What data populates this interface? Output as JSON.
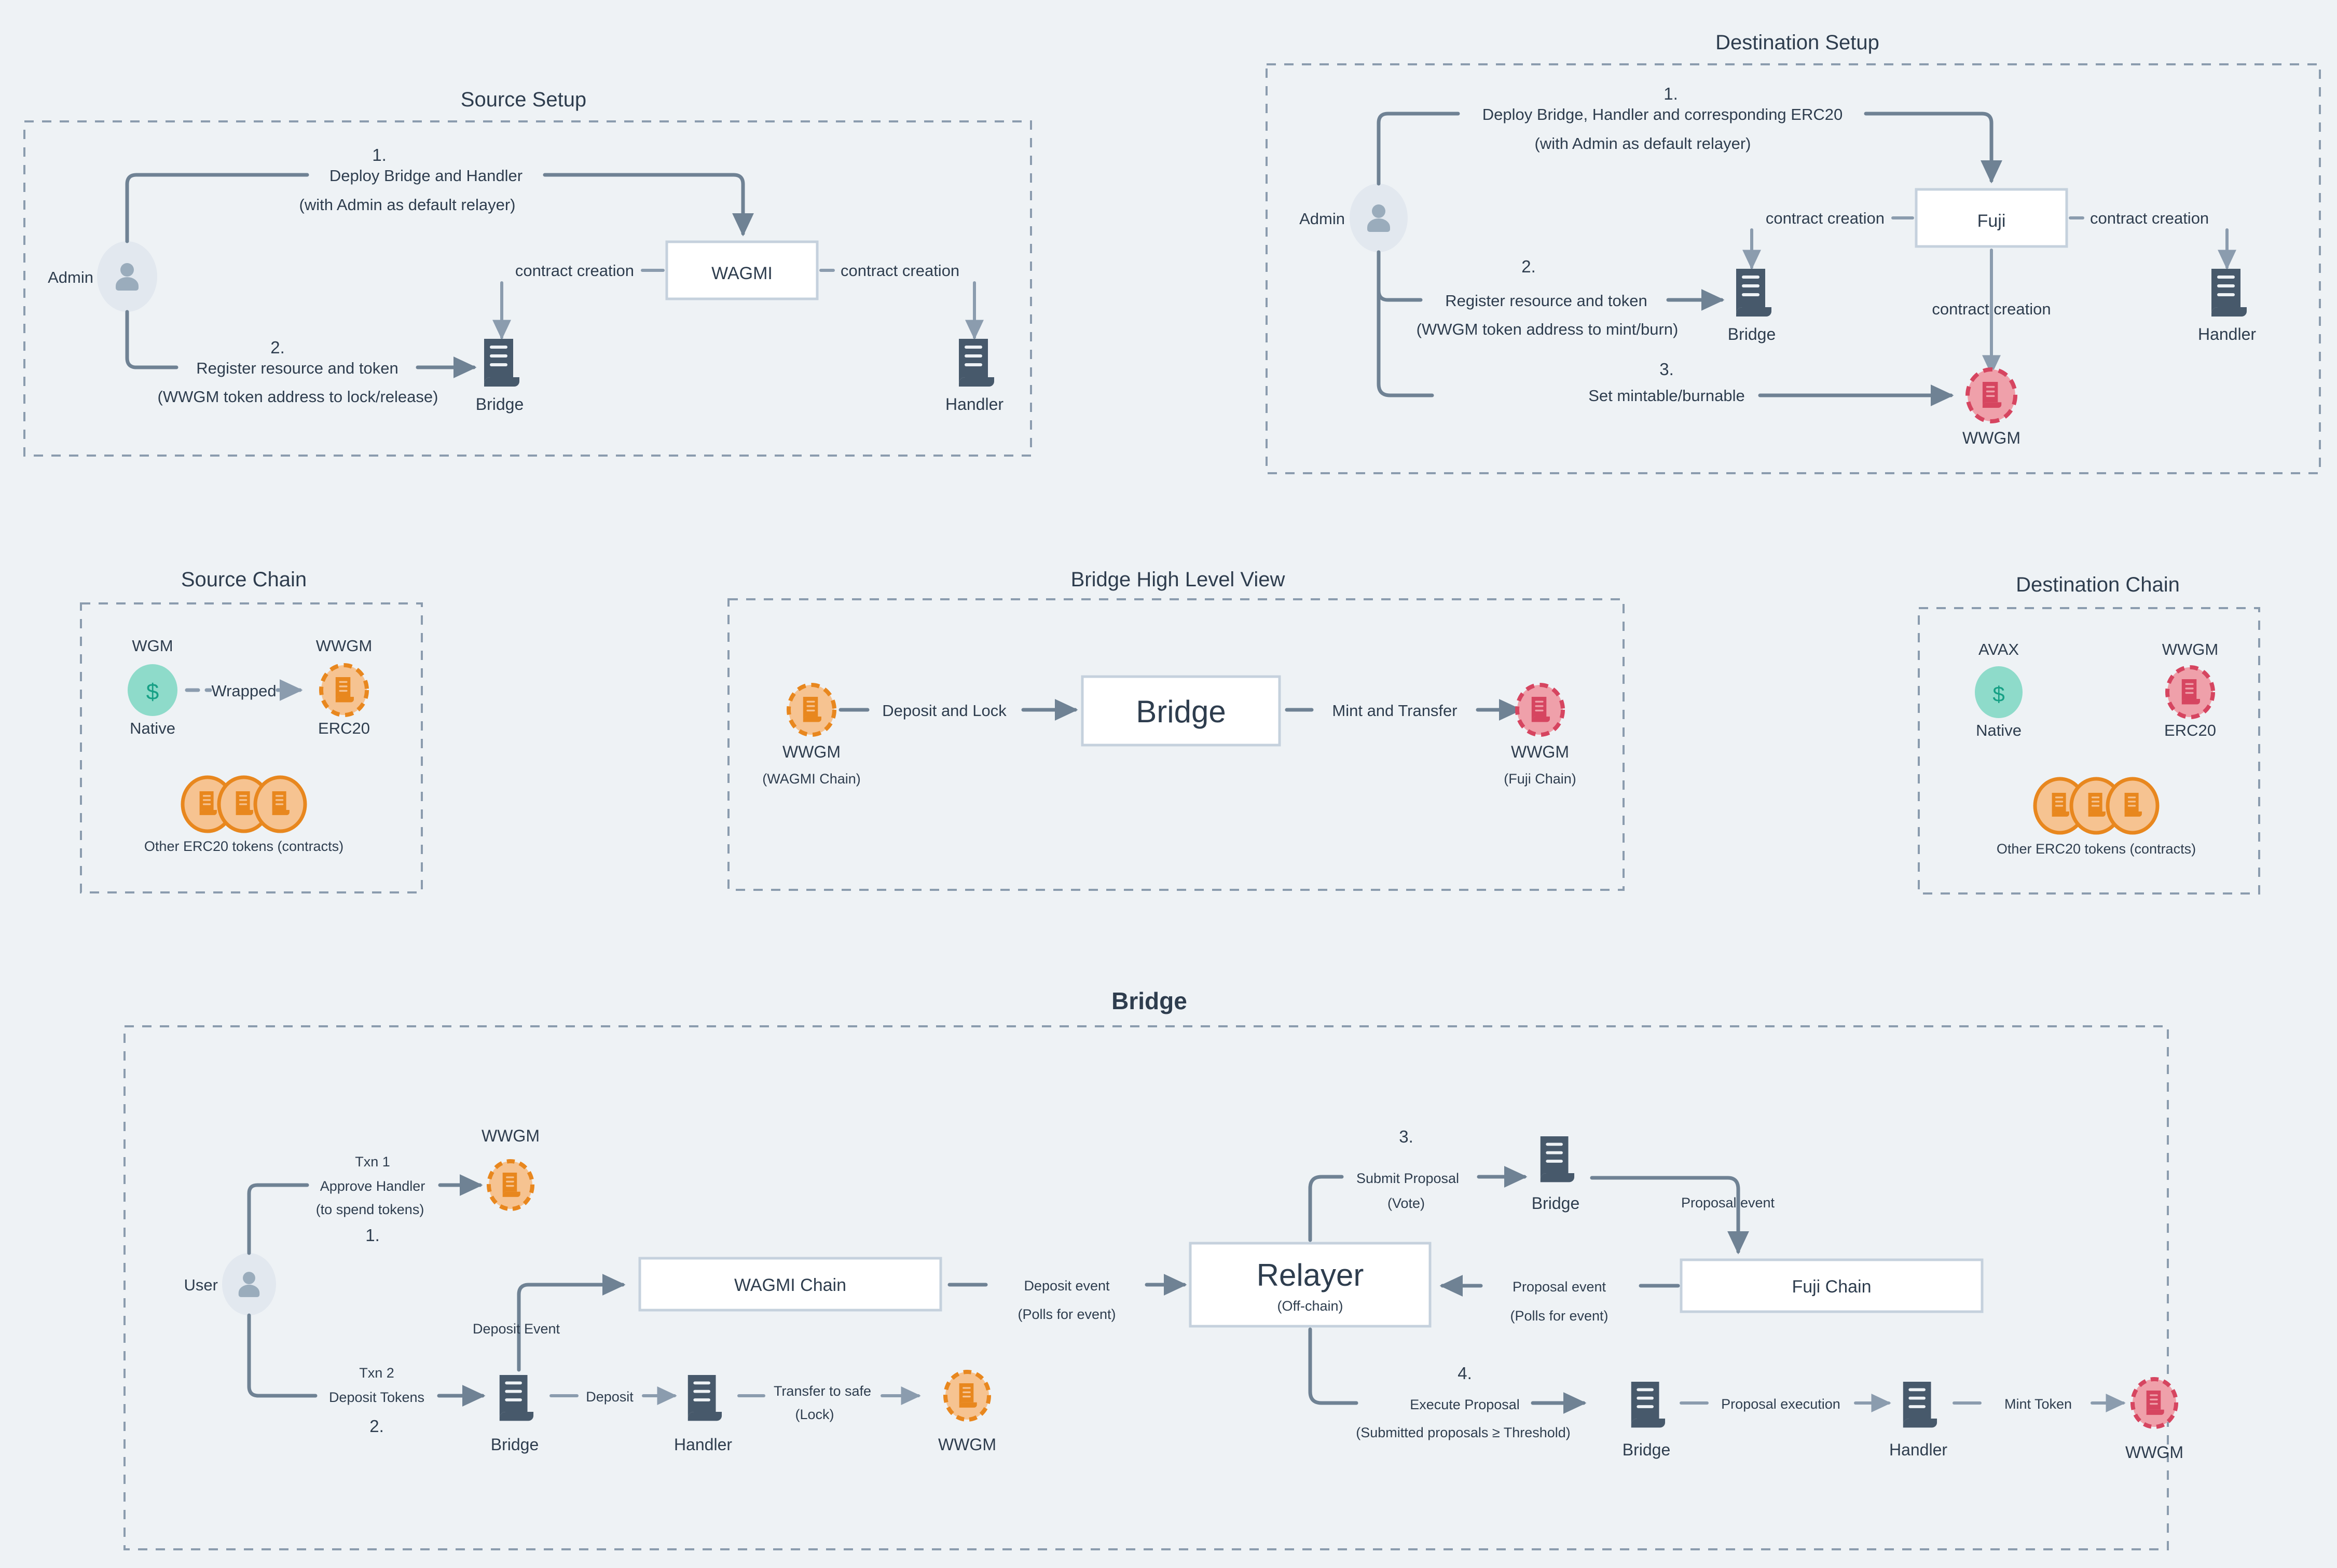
{
  "sections": {
    "source_setup": {
      "title": "Source Setup",
      "actor": "Admin",
      "step1_num": "1.",
      "step1_label": "Deploy Bridge and Handler",
      "step1_sub": "(with Admin as default relayer)",
      "step2_num": "2.",
      "step2_label": "Register resource and token",
      "step2_sub": "(WWGM token address to lock/release)",
      "chain_box": "WAGMI",
      "contract_creation_left": "contract creation",
      "contract_creation_right": "contract creation",
      "bridge": "Bridge",
      "handler": "Handler"
    },
    "destination_setup": {
      "title": "Destination Setup",
      "actor": "Admin",
      "step1_num": "1.",
      "step1_label": "Deploy Bridge, Handler and corresponding ERC20",
      "step1_sub": "(with Admin as default relayer)",
      "step2_num": "2.",
      "step2_label": "Register resource and token",
      "step2_sub": "(WWGM token address to mint/burn)",
      "step3_num": "3.",
      "step3_label": "Set mintable/burnable",
      "chain_box": "Fuji",
      "contract_creation_left": "contract creation",
      "contract_creation_right": "contract creation",
      "contract_creation_down": "contract creation",
      "bridge": "Bridge",
      "handler": "Handler",
      "token": "WWGM"
    },
    "source_chain": {
      "title": "Source Chain",
      "native_symbol": "WGM",
      "native_glyph": "$",
      "native_kind": "Native",
      "wrapped_symbol": "WWGM",
      "wrapped_kind": "ERC20",
      "edge_label": "Wrapped",
      "others_label": "Other ERC20 tokens (contracts)"
    },
    "bridge_high_level": {
      "title": "Bridge High Level View",
      "left_token": "WWGM",
      "left_token_sub": "(WAGMI Chain)",
      "left_edge": "Deposit and Lock",
      "center_box": "Bridge",
      "right_edge": "Mint and Transfer",
      "right_token": "WWGM",
      "right_token_sub": "(Fuji Chain)"
    },
    "destination_chain": {
      "title": "Destination Chain",
      "native_symbol": "AVAX",
      "native_glyph": "$",
      "native_kind": "Native",
      "wrapped_symbol": "WWGM",
      "wrapped_kind": "ERC20",
      "others_label": "Other ERC20 tokens (contracts)"
    },
    "bridge_detail": {
      "title": "Bridge",
      "actor": "User",
      "txn1_head": "Txn 1",
      "txn1_label": "Approve Handler",
      "txn1_sub": "(to spend tokens)",
      "txn1_num": "1.",
      "txn1_target": "WWGM",
      "txn2_head": "Txn 2",
      "txn2_label": "Deposit Tokens",
      "txn2_num": "2.",
      "bridge_left": "Bridge",
      "deposit_edge": "Deposit",
      "handler_left": "Handler",
      "transfer_edge": "Transfer to safe",
      "transfer_edge_sub": "(Lock)",
      "wwgm_left": "WWGM",
      "deposit_event_vertical": "Deposit Event",
      "wagmi_chain_box": "WAGMI Chain",
      "deposit_event_edge": "Deposit event",
      "deposit_event_sub": "(Polls for event)",
      "relayer_box": "Relayer",
      "relayer_sub": "(Off-chain)",
      "step3_num": "3.",
      "step3_label": "Submit Proposal",
      "step3_sub": "(Vote)",
      "bridge_top": "Bridge",
      "proposal_event_down": "Proposal event",
      "fuji_chain_box": "Fuji Chain",
      "proposal_event_back": "Proposal event",
      "proposal_event_back_sub": "(Polls for event)",
      "step4_num": "4.",
      "step4_label": "Execute Proposal",
      "step4_sub": "(Submitted proposals ≥ Threshold)",
      "bridge_bottom": "Bridge",
      "proposal_execution_edge": "Proposal execution",
      "handler_bottom": "Handler",
      "mint_token_edge": "Mint Token",
      "wwgm_right": "WWGM"
    }
  },
  "icons": {
    "person": "person-icon",
    "contract": "contract-document-icon",
    "token_orange": "orange-token-icon",
    "token_red": "red-token-icon",
    "native_coin": "native-coin-icon"
  },
  "colors": {
    "background": "#eef2f5",
    "ink": "#2e3d4e",
    "edge": "#6f8294",
    "dashed_border": "#8b9cae",
    "box_border": "#c5d1dd",
    "box_fill": "#ffffff",
    "person_circle": "#e2e8ef",
    "person_glyph": "#9aacbc",
    "contract_dark": "#47596b",
    "token_orange_fill": "#f6c391",
    "token_orange_stroke": "#e8871e",
    "token_red_fill": "#efa0aa",
    "token_red_stroke": "#d64560",
    "native_fill": "#8edbca",
    "native_glyph": "#16a085"
  }
}
